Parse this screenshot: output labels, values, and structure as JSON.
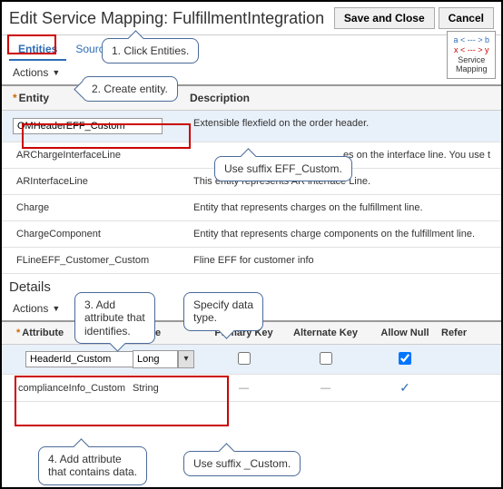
{
  "header": {
    "title": "Edit Service Mapping: FulfillmentIntegration",
    "save": "Save and Close",
    "cancel": "Cancel"
  },
  "tabs": {
    "entities": "Entities",
    "sources": "Sources"
  },
  "actions": "Actions",
  "svcmap": {
    "l1": "a < --- > b",
    "l2": "x < --- > y",
    "l3": "Service",
    "l4": "Mapping"
  },
  "entityTable": {
    "hdr": {
      "entity": "Entity",
      "desc": "Description"
    },
    "rows": [
      {
        "name": "OMHeaderEFF_Custom",
        "desc": "Extensible flexfield on the order header."
      },
      {
        "name": "ARChargeInterfaceLine",
        "desc": "es on the interface line. You use t"
      },
      {
        "name": "ARInterfaceLine",
        "desc": "This entity represents AR interface Line."
      },
      {
        "name": "Charge",
        "desc": "Entity that represents charges on the fulfillment line."
      },
      {
        "name": "ChargeComponent",
        "desc": "Entity that represents charge components on the fulfillment line."
      },
      {
        "name": "FLineEFF_Customer_Custom",
        "desc": "Fline EFF for customer info"
      }
    ]
  },
  "details": {
    "title": "Details",
    "hdr": {
      "attr": "Attribute",
      "type": "Type",
      "pk": "Primary Key",
      "ak": "Alternate Key",
      "an": "Allow Null",
      "ref": "Refer"
    },
    "rows": [
      {
        "attr": "HeaderId_Custom",
        "type": "Long",
        "pk": "box",
        "ak": "box",
        "an": "boxchecked"
      },
      {
        "attr": "complianceInfo_Custom",
        "type": "String",
        "pk": "dash",
        "ak": "dash",
        "an": "check"
      }
    ]
  },
  "callouts": {
    "c1": "1. Click Entities.",
    "c2": "2. Create entity.",
    "c3a": "3. Add",
    "c3b": "attribute that",
    "c3c": "identifies.",
    "csdt1": "Specify data",
    "csdt2": "type.",
    "c4a": "4. Add attribute",
    "c4b": "that contains data.",
    "suffix1": "Use suffix EFF_Custom.",
    "suffix2": "Use suffix _Custom."
  },
  "asterisk": "*"
}
